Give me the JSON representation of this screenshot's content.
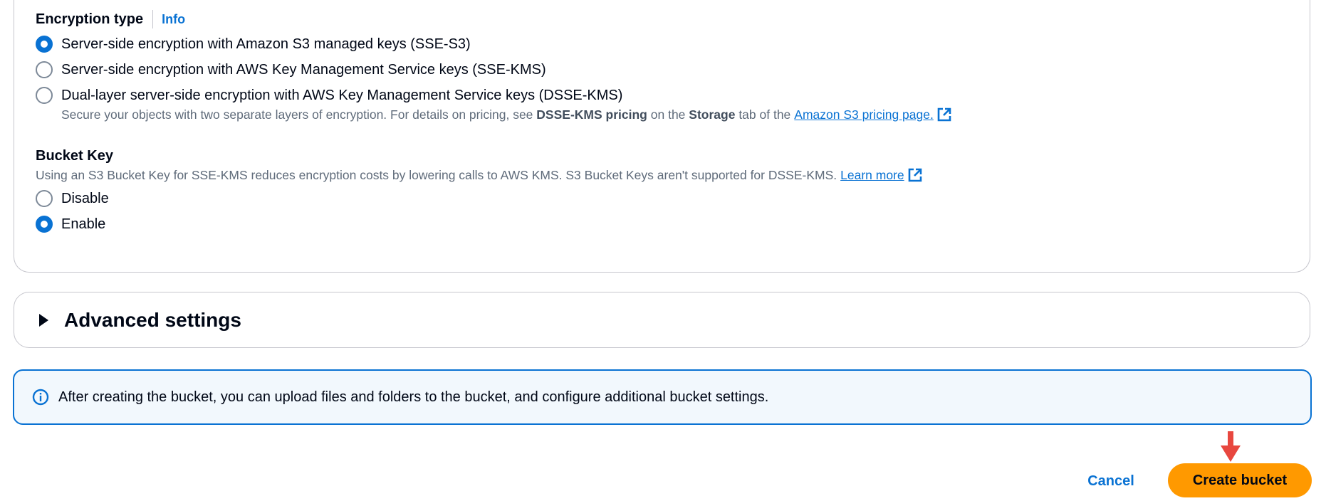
{
  "encryption": {
    "label": "Encryption type",
    "info": "Info",
    "options": [
      {
        "label": "Server-side encryption with Amazon S3 managed keys (SSE-S3)",
        "checked": true
      },
      {
        "label": "Server-side encryption with AWS Key Management Service keys (SSE-KMS)",
        "checked": false
      },
      {
        "label": "Dual-layer server-side encryption with AWS Key Management Service keys (DSSE-KMS)",
        "checked": false
      }
    ],
    "dsse_desc": {
      "part1": "Secure your objects with two separate layers of encryption. For details on pricing, see",
      "bold1": "DSSE-KMS pricing",
      "part2": "on the",
      "bold2": "Storage",
      "part3": "tab of the",
      "link": "Amazon S3 pricing page."
    }
  },
  "bucket_key": {
    "label": "Bucket Key",
    "desc": "Using an S3 Bucket Key for SSE-KMS reduces encryption costs by lowering calls to AWS KMS. S3 Bucket Keys aren't supported for DSSE-KMS.",
    "learn_more": "Learn more",
    "options": [
      {
        "label": "Disable",
        "checked": false
      },
      {
        "label": "Enable",
        "checked": true
      }
    ]
  },
  "advanced": {
    "title": "Advanced settings"
  },
  "alert": {
    "text": "After creating the bucket, you can upload files and folders to the bucket, and configure additional bucket settings."
  },
  "actions": {
    "cancel": "Cancel",
    "create": "Create bucket"
  },
  "colors": {
    "accent": "#0972d3",
    "primary_button": "#ff9900",
    "marker": "#e8473f"
  },
  "icons": {
    "external": "external-link-icon",
    "info": "info-circle-icon",
    "caret": "caret-right-icon",
    "marker": "arrow-down-marker"
  }
}
